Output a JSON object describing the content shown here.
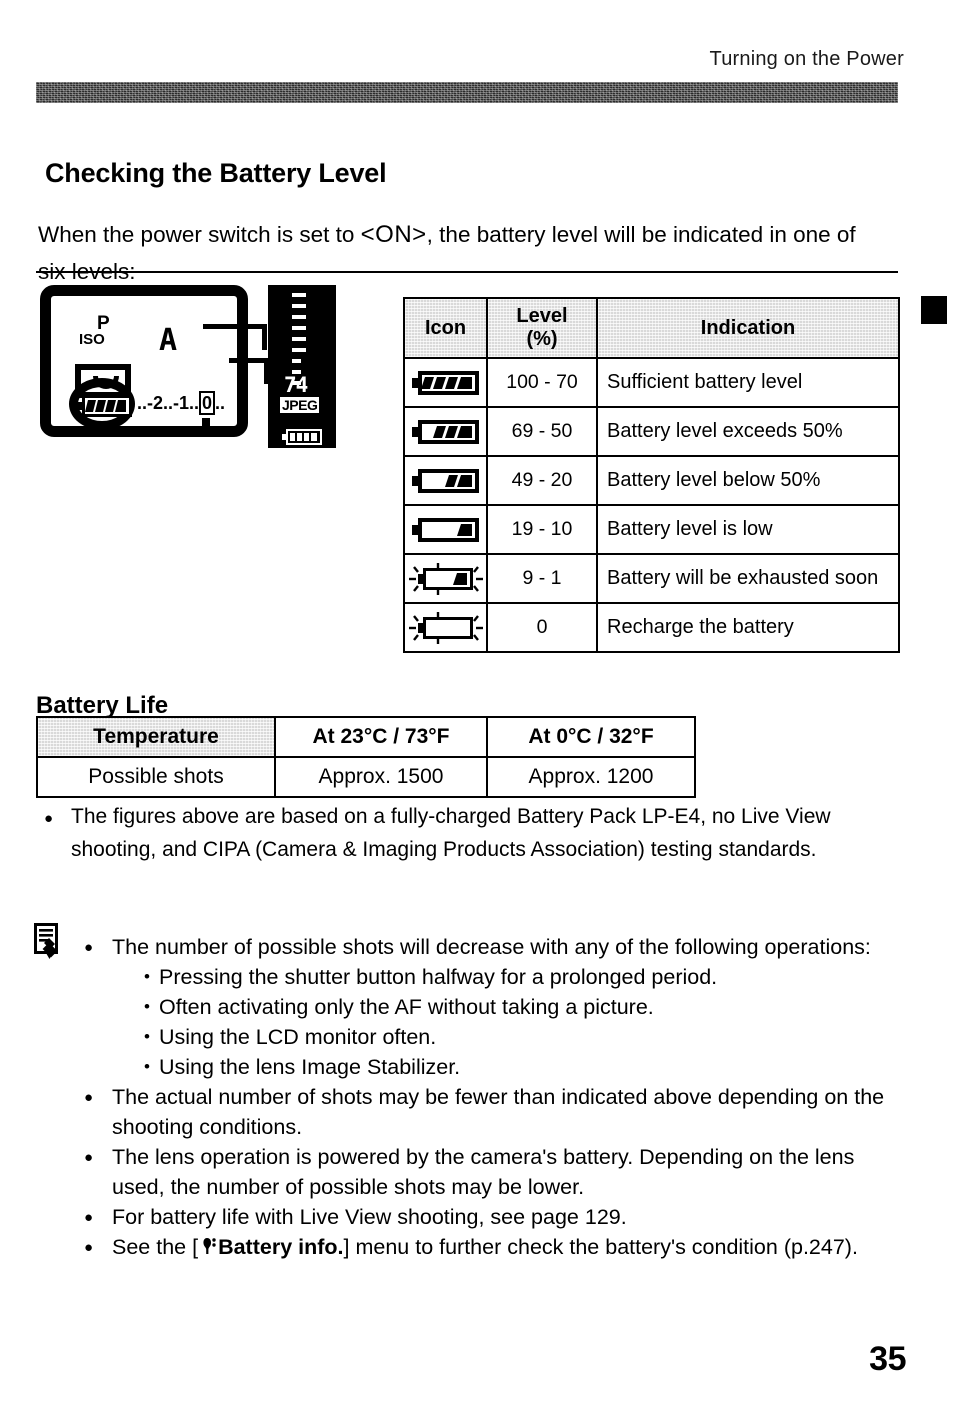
{
  "header": {
    "running_head": "Turning on the Power"
  },
  "section": {
    "title": "Checking the Battery Level",
    "intro_before": "When the power switch is set to ",
    "intro_token": "<ON>",
    "intro_after": ", the battery level will be indicated in one of six levels:"
  },
  "lcd_panel": {
    "mode": "P",
    "iso_label": "ISO",
    "iso_value": "A",
    "exposure_scale": "..-2..-1..",
    "exposure_zero": "0",
    "exposure_tail": "..",
    "sub_panel": {
      "shots_remaining": "74",
      "quality": "JPEG"
    }
  },
  "level_table": {
    "columns": [
      "Icon",
      "Level\n(%)",
      "Indication"
    ],
    "column_icon": "Icon",
    "column_level_line1": "Level",
    "column_level_line2": "(%)",
    "column_indication": "Indication",
    "rows": [
      {
        "icon": "battery-full-icon",
        "bars": 4,
        "blinking": false,
        "level": "100 - 70",
        "indication": "Sufficient battery level"
      },
      {
        "icon": "battery-three-quarter-icon",
        "bars": 3,
        "blinking": false,
        "level": "69 - 50",
        "indication": "Battery level exceeds 50%"
      },
      {
        "icon": "battery-half-icon",
        "bars": 2,
        "blinking": false,
        "level": "49 - 20",
        "indication": "Battery level below 50%"
      },
      {
        "icon": "battery-low-icon",
        "bars": 1,
        "blinking": false,
        "level": "19 - 10",
        "indication": "Battery level is low"
      },
      {
        "icon": "battery-blinking-low-icon",
        "bars": 1,
        "blinking": true,
        "level": "9 - 1",
        "indication": "Battery will be exhausted soon"
      },
      {
        "icon": "battery-empty-blinking-icon",
        "bars": 0,
        "blinking": true,
        "level": "0",
        "indication": "Recharge the battery"
      }
    ]
  },
  "battery_life": {
    "title": "Battery Life",
    "columns": [
      "Temperature",
      "At 23°C / 73°F",
      "At 0°C / 32°F"
    ],
    "row_label": "Possible shots",
    "values": [
      "Approx. 1500",
      "Approx. 1200"
    ]
  },
  "cipa_note": {
    "bullet": "●",
    "text": "The figures above are based on a fully-charged Battery Pack LP-E4, no Live View shooting, and CIPA (Camera & Imaging Products Association) testing standards."
  },
  "notes": {
    "icon": "note-pencil-icon",
    "bullet": "●",
    "sub_bullet": "•",
    "items": [
      {
        "text": "The number of possible shots will decrease with any of the following operations:",
        "sub_items": [
          "Pressing the shutter button halfway for a prolonged period.",
          "Often activating only the AF without taking a picture.",
          "Using the LCD monitor often.",
          "Using the lens Image Stabilizer."
        ]
      },
      {
        "text": "The actual number of shots may be fewer than indicated above depending on the shooting conditions.",
        "sub_items": []
      },
      {
        "text": "The lens operation is powered by the camera's battery. Depending on the lens used, the number of possible shots may be lower.",
        "sub_items": []
      },
      {
        "text": "For battery life with Live View shooting, see page 129.",
        "sub_items": []
      }
    ],
    "last_item": {
      "prefix": "See the [",
      "menu_icon": "setup-wrench-icon",
      "menu_label": "Battery info.",
      "suffix": "] menu to further check the battery's condition (p.247)."
    }
  },
  "page_number": "35",
  "colors": {
    "ink": "#000000",
    "paper": "#ffffff",
    "header_bar": "#2b2b2b",
    "table_header_fill": "#d9d9d9"
  }
}
